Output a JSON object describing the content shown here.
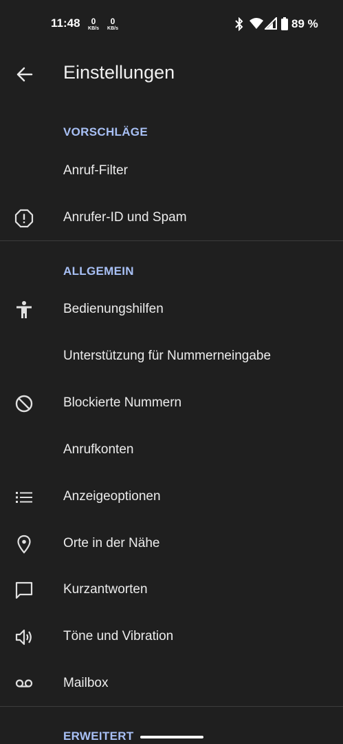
{
  "status_bar": {
    "time": "11:48",
    "net_down_value": "0",
    "net_down_unit": "KB/s",
    "net_up_value": "0",
    "net_up_unit": "KB/s",
    "battery": "89 %",
    "icons": [
      "bluetooth-icon",
      "wifi-icon",
      "signal-icon",
      "battery-icon"
    ]
  },
  "app_bar": {
    "title": "Einstellungen"
  },
  "sections": {
    "suggestions": {
      "header": "VORSCHLÄGE",
      "items": [
        {
          "label": "Anruf-Filter",
          "icon": ""
        },
        {
          "label": "Anrufer-ID und Spam",
          "icon": "alert-octagon-icon"
        }
      ]
    },
    "general": {
      "header": "ALLGEMEIN",
      "items": [
        {
          "label": "Bedienungshilfen",
          "icon": "accessibility-icon"
        },
        {
          "label": "Unterstützung für Nummerneingabe",
          "icon": ""
        },
        {
          "label": "Blockierte Nummern",
          "icon": "block-icon"
        },
        {
          "label": "Anrufkonten",
          "icon": ""
        },
        {
          "label": "Anzeigeoptionen",
          "icon": "list-icon"
        },
        {
          "label": "Orte in der Nähe",
          "icon": "location-pin-icon"
        },
        {
          "label": "Kurzantworten",
          "icon": "chat-bubble-icon"
        },
        {
          "label": "Töne und Vibration",
          "icon": "volume-icon"
        },
        {
          "label": "Mailbox",
          "icon": "voicemail-icon"
        }
      ]
    },
    "advanced": {
      "header": "ERWEITERT"
    }
  },
  "colors": {
    "background": "#1f1f1f",
    "section_header": "#a8c0f5",
    "text": "#ececec",
    "divider": "#3c3c3c"
  }
}
